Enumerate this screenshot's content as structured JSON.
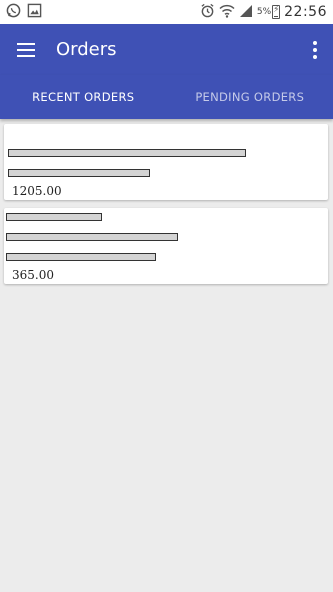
{
  "status_bar": {
    "left_icons": [
      "whatsapp-icon",
      "image-icon"
    ],
    "right_icons": [
      "alarm-icon",
      "wifi-icon",
      "signal-icon",
      "battery-icon"
    ],
    "battery_percent": "5%",
    "time": "22:56"
  },
  "app_bar": {
    "title": "Orders",
    "menu_icon": "hamburger-menu-icon",
    "overflow_icon": "more-vert-icon",
    "color": "#3f51b5"
  },
  "tabs": [
    {
      "label": "RECENT ORDERS",
      "selected": true
    },
    {
      "label": "PENDING ORDERS",
      "selected": false
    }
  ],
  "orders": [
    {
      "amount": "1205.00"
    },
    {
      "amount": "365.00"
    }
  ]
}
